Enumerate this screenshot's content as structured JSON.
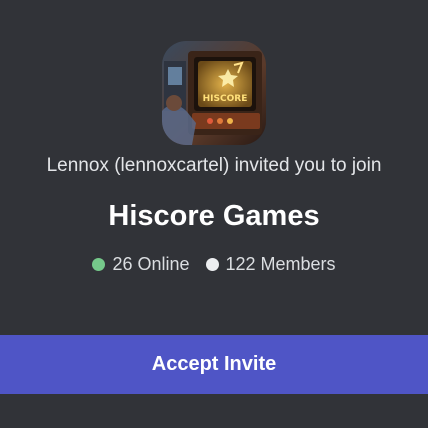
{
  "invite": {
    "inviter_text": "Lennox (lennoxcartel) invited you to join",
    "server_name": "Hiscore Games",
    "online_count": "26 Online",
    "member_count": "122 Members",
    "accept_label": "Accept Invite"
  },
  "server_icon": {
    "name": "arcade-machine-icon",
    "screen_text": "HISCORE"
  },
  "colors": {
    "background": "#313338",
    "button": "#4f55c6",
    "online_dot": "#75c98a",
    "members_dot": "#eceef0",
    "text_primary": "#ffffff",
    "text_secondary": "#e3e5e8"
  }
}
